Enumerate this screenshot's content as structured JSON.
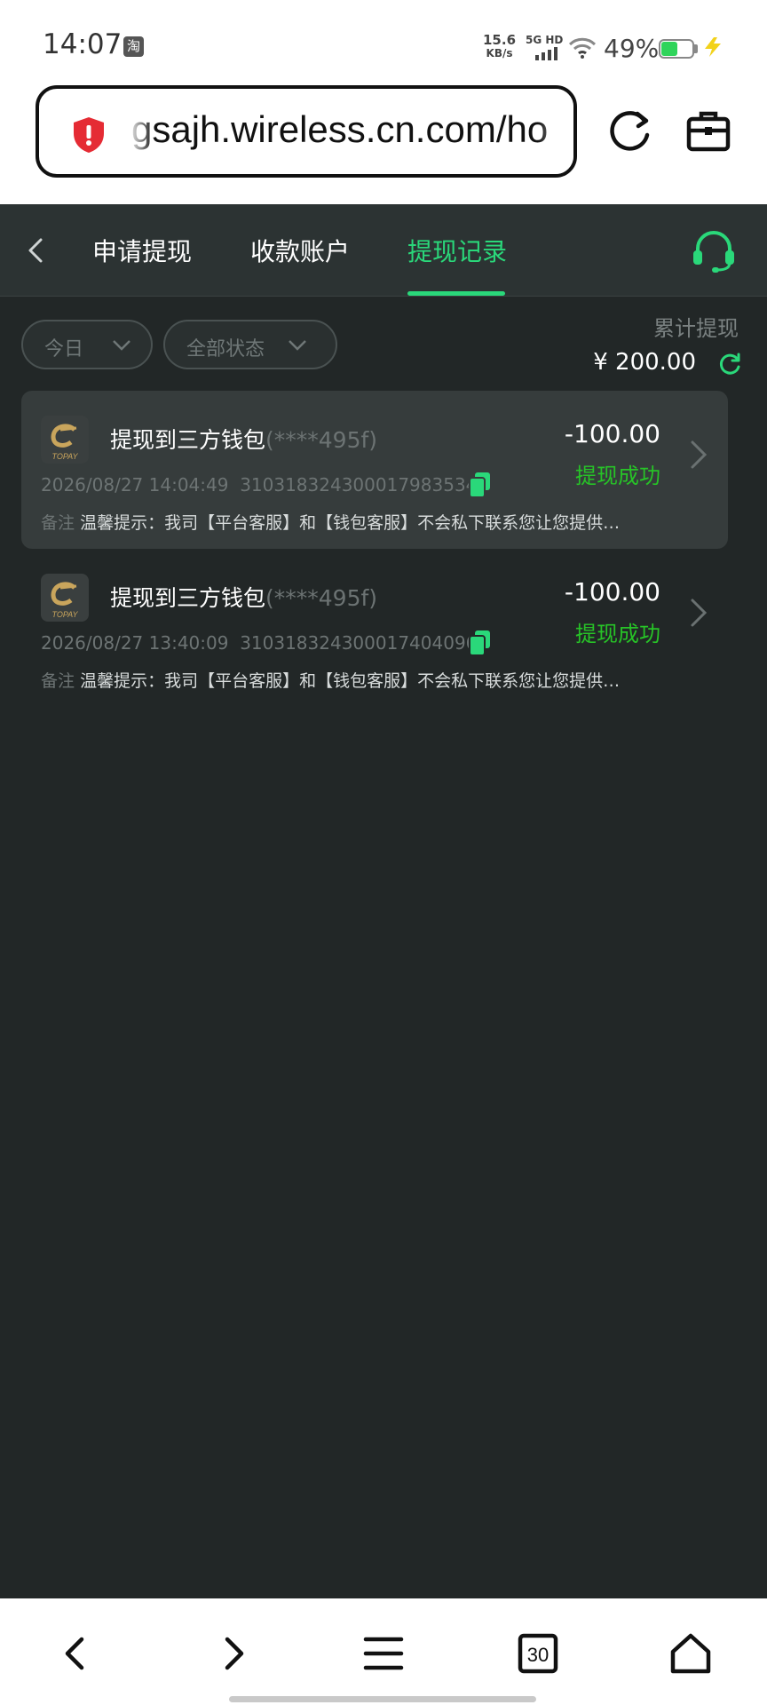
{
  "status_bar": {
    "time": "14:07",
    "app_icon_text": "淘",
    "net_speed_value": "15.6",
    "net_speed_unit": "KB/s",
    "network_type": "5G HD",
    "battery_percent": "49%",
    "battery_level": 0.49
  },
  "browser": {
    "url": "gsajh.wireless.cn.com/ho",
    "security_icon": "shield-warning-icon",
    "reload_icon": "reload-icon",
    "toolbox_icon": "toolbox-icon"
  },
  "app": {
    "tabs": [
      {
        "label": "申请提现",
        "active": false
      },
      {
        "label": "收款账户",
        "active": false
      },
      {
        "label": "提现记录",
        "active": true
      }
    ],
    "accent_color": "#2ad87a",
    "filters": [
      {
        "label": "今日"
      },
      {
        "label": "全部状态"
      }
    ],
    "total": {
      "label": "累计提现",
      "value": "¥ 200.00"
    },
    "records": [
      {
        "title": "提现到三方钱包",
        "account_mask": "(****495f)",
        "amount": "-100.00",
        "status": "提现成功",
        "datetime": "2026/08/27 14:04:49",
        "order_id": "310318324300017983534",
        "note_label": "备注",
        "note_text": "温馨提示：我司【平台客服】和【钱包客服】不会私下联系您让您提供…",
        "logo_text": "TOPAY",
        "highlighted": true
      },
      {
        "title": "提现到三方钱包",
        "account_mask": "(****495f)",
        "amount": "-100.00",
        "status": "提现成功",
        "datetime": "2026/08/27 13:40:09",
        "order_id": "310318324300017404096",
        "note_label": "备注",
        "note_text": "温馨提示：我司【平台客服】和【钱包客服】不会私下联系您让您提供…",
        "logo_text": "TOPAY",
        "highlighted": false
      }
    ]
  },
  "bottom_nav": {
    "tab_count": "30"
  }
}
